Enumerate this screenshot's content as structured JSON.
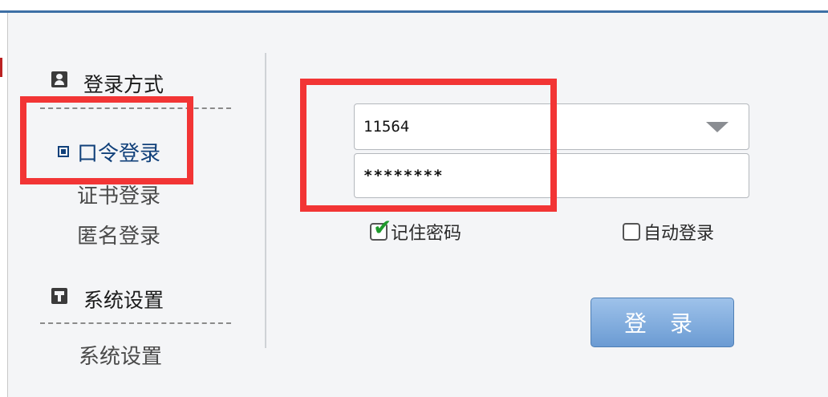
{
  "sidebar": {
    "login_method": {
      "title": "登录方式",
      "items": [
        {
          "label": "口令登录",
          "active": true
        },
        {
          "label": "证书登录",
          "active": false
        },
        {
          "label": "匿名登录",
          "active": false
        }
      ]
    },
    "system_settings": {
      "title": "系统设置",
      "items": [
        {
          "label": "系统设置"
        }
      ]
    }
  },
  "form": {
    "username": "11564",
    "password": "********",
    "remember_password": {
      "label": "记住密码",
      "checked": true
    },
    "auto_login": {
      "label": "自动登录",
      "checked": false
    },
    "login_button": "登 录"
  },
  "colors": {
    "highlight": "#f23535",
    "accent": "#10407a",
    "button": "#7aa6db",
    "check": "#1f9a2c"
  }
}
